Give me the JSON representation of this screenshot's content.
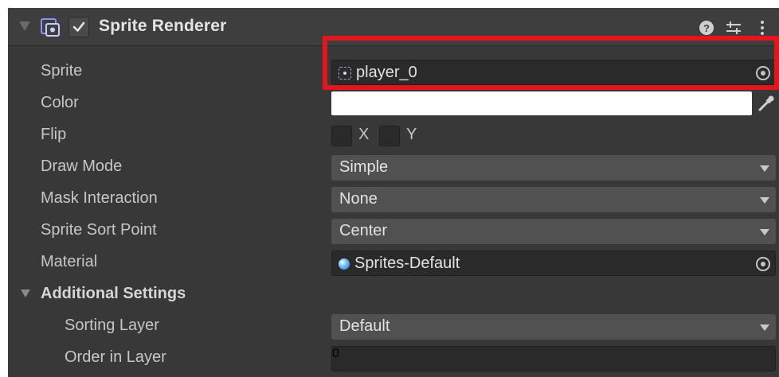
{
  "component": {
    "title": "Sprite Renderer",
    "enabled": true
  },
  "fields": {
    "sprite": {
      "label": "Sprite",
      "value": "player_0"
    },
    "color": {
      "label": "Color",
      "value": "#ffffff"
    },
    "flip": {
      "label": "Flip",
      "x_label": "X",
      "y_label": "Y",
      "x_checked": false,
      "y_checked": false
    },
    "draw_mode": {
      "label": "Draw Mode",
      "value": "Simple"
    },
    "mask_interaction": {
      "label": "Mask Interaction",
      "value": "None"
    },
    "sprite_sort_point": {
      "label": "Sprite Sort Point",
      "value": "Center"
    },
    "material": {
      "label": "Material",
      "value": "Sprites-Default"
    }
  },
  "additional_settings": {
    "label": "Additional Settings",
    "sorting_layer": {
      "label": "Sorting Layer",
      "value": "Default"
    },
    "order_in_layer": {
      "label": "Order in Layer",
      "value": "0"
    }
  },
  "colors": {
    "highlight": "#e3161d",
    "panel_bg": "#383838",
    "header_bg": "#3e3e3e"
  },
  "icons": [
    "sprite-renderer-icon",
    "checkbox-checked-icon",
    "help-icon",
    "presets-icon",
    "more-options-icon",
    "object-picker-icon",
    "eyedropper-icon",
    "sprite-asset-icon",
    "material-asset-icon"
  ]
}
